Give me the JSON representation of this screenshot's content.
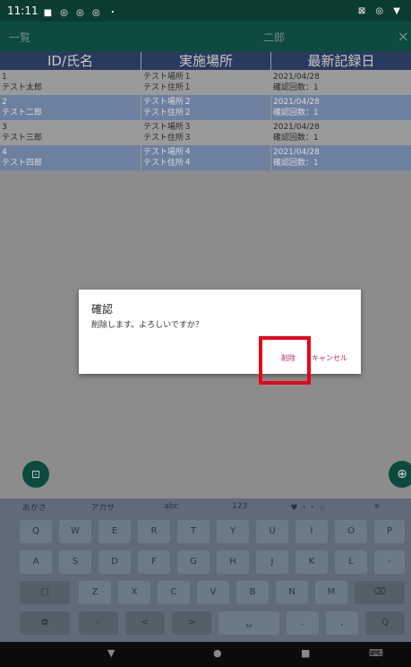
{
  "statusbar": {
    "time": "11:11",
    "icons": "■ ◎ ◎ ◎ ・",
    "right": "⊠ ◎ ▼"
  },
  "appbar": {
    "left": "一覧",
    "center": "二郎",
    "close": "×"
  },
  "table": {
    "headers": [
      "ID/氏名",
      "実施場所",
      "最新記録日"
    ],
    "rows": [
      {
        "id": "1",
        "name": "テスト太郎",
        "place": "テスト場所１",
        "address": "テスト住所１",
        "date": "2021/04/28",
        "count": "確認回数：1"
      },
      {
        "id": "2",
        "name": "テスト二郎",
        "place": "テスト場所２",
        "address": "テスト住所２",
        "date": "2021/04/28",
        "count": "確認回数：1"
      },
      {
        "id": "3",
        "name": "テスト三郎",
        "place": "テスト場所３",
        "address": "テスト住所３",
        "date": "2021/04/28",
        "count": "確認回数：1"
      },
      {
        "id": "4",
        "name": "テスト四郎",
        "place": "テスト場所４",
        "address": "テスト住所４",
        "date": "2021/04/28",
        "count": "確認回数：1"
      }
    ]
  },
  "dialog": {
    "title": "確認",
    "message": "削除します。よろしいですか？",
    "delete_label": "削除",
    "cancel_label": "キャンセル"
  },
  "fabs": {
    "left": "⊡",
    "right": "⊕"
  },
  "keyboard": {
    "top": [
      "あかさ",
      "アカサ",
      "abc",
      "123",
      "♥ ・・ ☆",
      "×"
    ],
    "row1": [
      "Q",
      "W",
      "E",
      "R",
      "T",
      "Y",
      "U",
      "I",
      "O",
      "P"
    ],
    "row2": [
      "A",
      "S",
      "D",
      "F",
      "G",
      "H",
      "J",
      "K",
      "L",
      "-"
    ],
    "row3": [
      "□",
      "Z",
      "X",
      "C",
      "V",
      "B",
      "N",
      "M",
      "⌫"
    ],
    "row4": [
      "✿",
      "⁘",
      "<",
      ">",
      "␣",
      ".",
      ",",
      "Q"
    ]
  },
  "navbar": {
    "back": "▼",
    "home": "●",
    "recent": "■",
    "kb": "⌨"
  }
}
